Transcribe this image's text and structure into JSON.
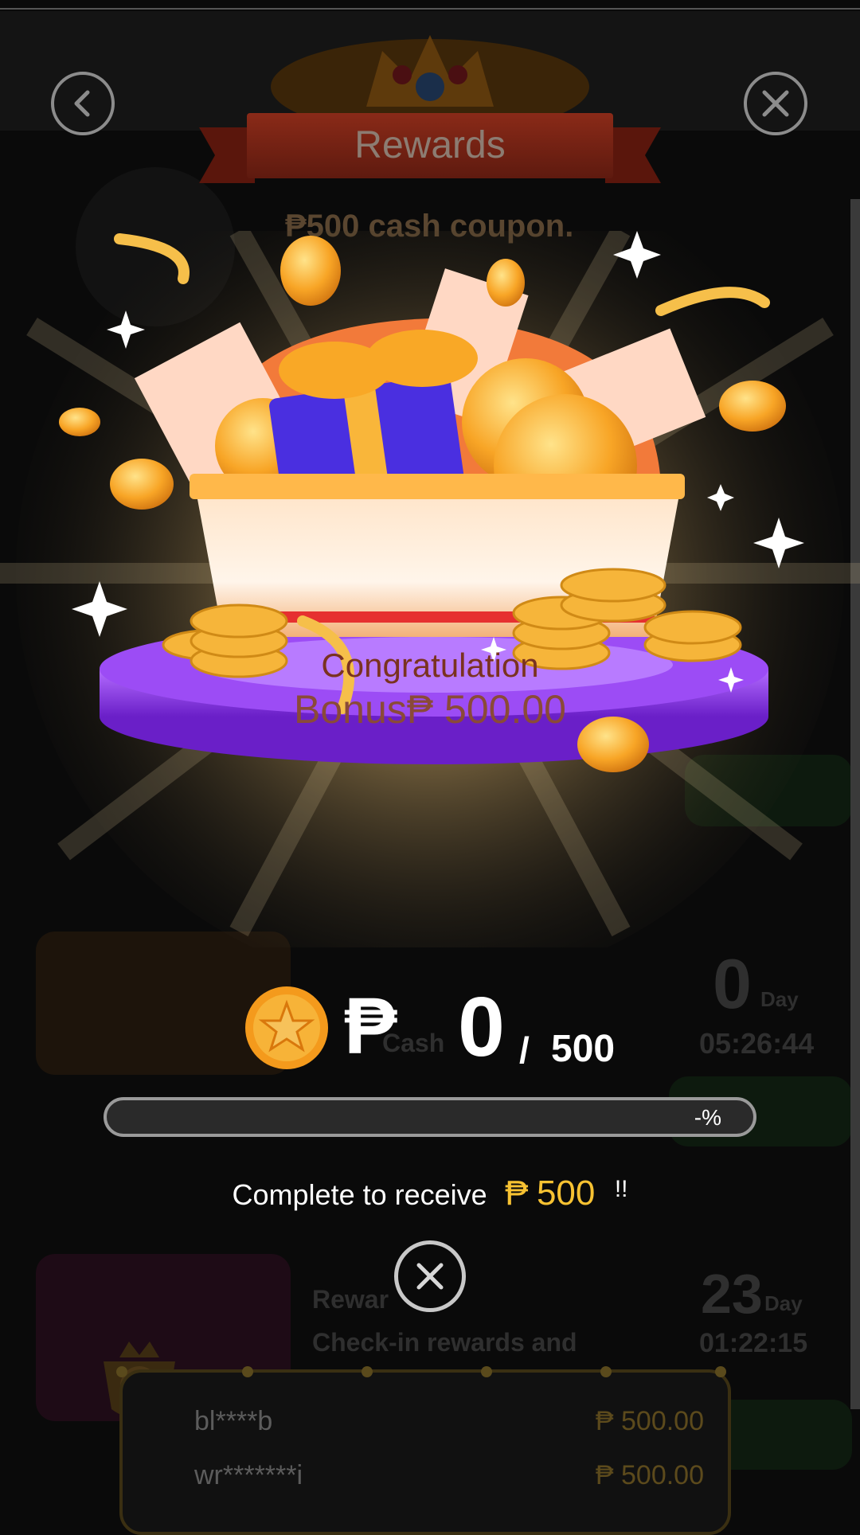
{
  "header": {
    "title": "Rewards"
  },
  "background": {
    "coupon_heading": "₱500 cash coupon.",
    "task_rows": [
      {
        "days": "0",
        "day_unit": "Day",
        "time": "05:26:44",
        "desc_fragment": "Cash"
      },
      {
        "days": "23",
        "day_unit": "Day",
        "time": "01:22:15",
        "desc_line1": "Rewar",
        "desc_line2": "Check-in rewards and"
      }
    ]
  },
  "popup": {
    "congrats_label": "Congratulation",
    "bonus_label": "Bonus₱ 500.00",
    "currency_symbol": "₱",
    "current_amount": "0",
    "separator": "/",
    "target_amount": "500",
    "progress_label": "-%",
    "progress_fraction": 0,
    "receive_text": "Complete to receive",
    "receive_currency": "₱",
    "receive_amount": "500",
    "receive_suffix": "!!"
  },
  "winners": [
    {
      "name": "bl****b",
      "amount": "₱ 500.00"
    },
    {
      "name": "wr*******i",
      "amount": "₱ 500.00"
    }
  ],
  "colors": {
    "accent_gold": "#f7c232",
    "purple": "#8a3cf0",
    "bonus_text": "#7a3a2a"
  },
  "icons": {
    "back": "chevron-left-icon",
    "close": "close-icon",
    "coin": "star-coin-icon"
  }
}
